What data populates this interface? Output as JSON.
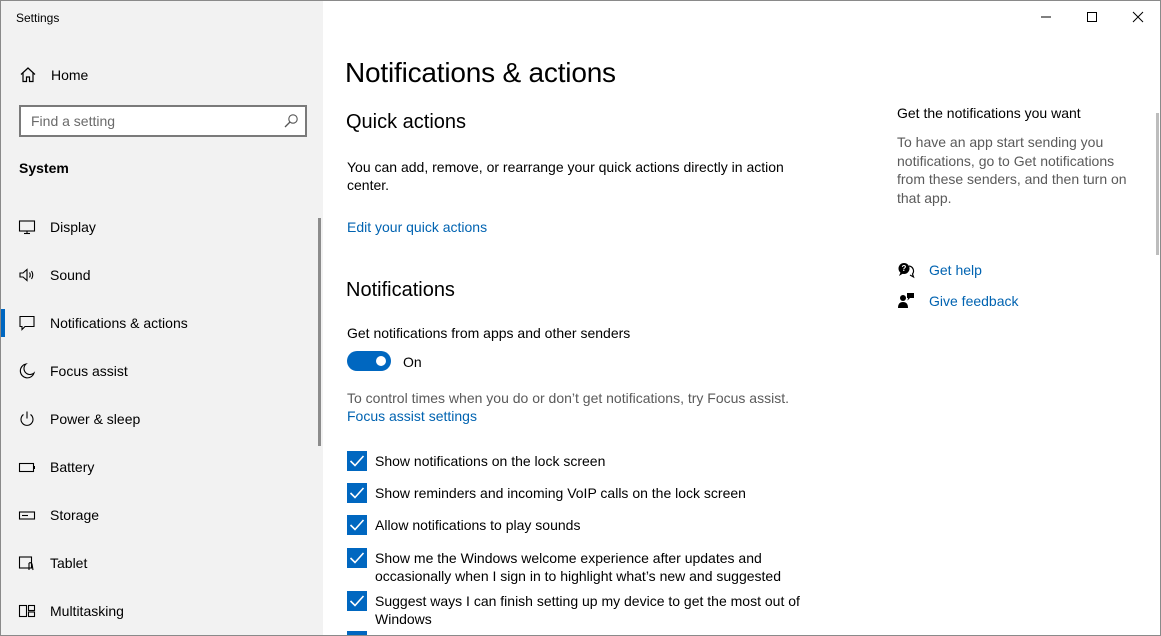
{
  "window": {
    "title": "Settings"
  },
  "sidebar": {
    "home_label": "Home",
    "search_placeholder": "Find a setting",
    "section": "System",
    "items": [
      {
        "label": "Display",
        "icon": "display-icon"
      },
      {
        "label": "Sound",
        "icon": "speaker-icon"
      },
      {
        "label": "Notifications & actions",
        "icon": "notification-icon",
        "selected": true
      },
      {
        "label": "Focus assist",
        "icon": "moon-icon"
      },
      {
        "label": "Power & sleep",
        "icon": "power-icon"
      },
      {
        "label": "Battery",
        "icon": "battery-icon"
      },
      {
        "label": "Storage",
        "icon": "storage-icon"
      },
      {
        "label": "Tablet",
        "icon": "tablet-icon"
      },
      {
        "label": "Multitasking",
        "icon": "multitasking-icon"
      }
    ]
  },
  "main": {
    "title": "Notifications & actions",
    "quick_actions": {
      "heading": "Quick actions",
      "description": "You can add, remove, or rearrange your quick actions directly in action center.",
      "link": "Edit your quick actions"
    },
    "notifications": {
      "heading": "Notifications",
      "toggle_caption": "Get notifications from apps and other senders",
      "toggle_state": "On",
      "focus_text": "To control times when you do or don’t get notifications, try Focus assist.",
      "focus_link": "Focus assist settings",
      "checkboxes": [
        {
          "label": "Show notifications on the lock screen",
          "checked": true
        },
        {
          "label": "Show reminders and incoming VoIP calls on the lock screen",
          "checked": true
        },
        {
          "label": "Allow notifications to play sounds",
          "checked": true
        },
        {
          "label": "Show me the Windows welcome experience after updates and occasionally when I sign in to highlight what’s new and suggested",
          "checked": true
        },
        {
          "label": "Suggest ways I can finish setting up my device to get the most out of Windows",
          "checked": true
        }
      ]
    }
  },
  "right_panel": {
    "title": "Get the notifications you want",
    "text": "To have an app start sending you notifications, go to Get notifications from these senders, and then turn on that app.",
    "get_help": "Get help",
    "give_feedback": "Give feedback"
  },
  "colors": {
    "accent": "#0067c0",
    "link": "#0063b1",
    "sidebar_bg": "#f2f2f2"
  }
}
